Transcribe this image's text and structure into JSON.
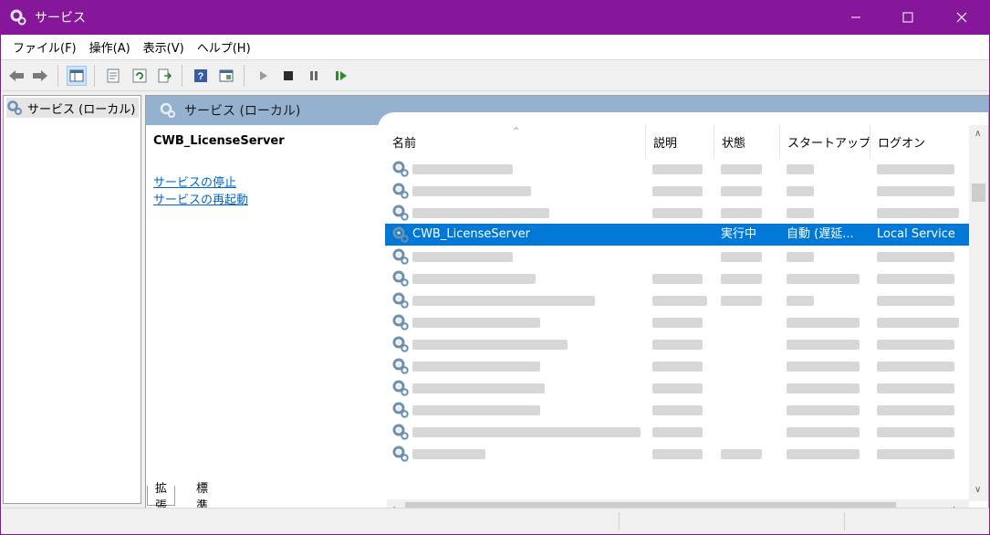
{
  "window": {
    "title": "サービス"
  },
  "menu": [
    "ファイル(F)",
    "操作(A)",
    "表示(V)",
    "ヘルプ(H)"
  ],
  "toolbar": {
    "icons": [
      "back-icon",
      "forward-icon",
      "show-tree-icon",
      "properties-icon",
      "refresh-icon",
      "export-icon",
      "help-icon",
      "console-icon",
      "start-icon",
      "stop-icon",
      "pause-icon",
      "restart-icon"
    ]
  },
  "tree": {
    "root_label": "サービス (ローカル)"
  },
  "pane": {
    "header": "サービス (ローカル)",
    "selected_service": "CWB_LicenseServer",
    "links": [
      "サービスの停止",
      "サービスの再起動"
    ]
  },
  "columns": [
    "名前",
    "説明",
    "状態",
    "スタートアップ...",
    "ログオン"
  ],
  "rows": [
    {
      "name": "",
      "desc": "",
      "status": "",
      "startup": "",
      "logon": "",
      "blurred": true
    },
    {
      "name": "",
      "desc": "",
      "status": "",
      "startup": "",
      "logon": "",
      "blurred": true
    },
    {
      "name": "",
      "desc": "",
      "status": "",
      "startup": "",
      "logon": "",
      "blurred": true
    },
    {
      "name": "CWB_LicenseServer",
      "desc": "",
      "status": "実行中",
      "startup": "自動 (遅延...",
      "logon": "Local Service",
      "selected": true
    },
    {
      "name": "",
      "desc": "",
      "status": "",
      "startup": "",
      "logon": "",
      "blurred": true
    },
    {
      "name": "",
      "desc": "",
      "status": "",
      "startup": "",
      "logon": "",
      "blurred": true
    },
    {
      "name": "",
      "desc": "",
      "status": "",
      "startup": "",
      "logon": "",
      "blurred": true
    },
    {
      "name": "",
      "desc": "",
      "status": "",
      "startup": "",
      "logon": "",
      "blurred": true
    },
    {
      "name": "",
      "desc": "",
      "status": "",
      "startup": "",
      "logon": "",
      "blurred": true
    },
    {
      "name": "",
      "desc": "",
      "status": "",
      "startup": "",
      "logon": "",
      "blurred": true
    },
    {
      "name": "",
      "desc": "",
      "status": "",
      "startup": "",
      "logon": "",
      "blurred": true
    },
    {
      "name": "",
      "desc": "",
      "status": "",
      "startup": "",
      "logon": "",
      "blurred": true
    },
    {
      "name": "",
      "desc": "",
      "status": "",
      "startup": "",
      "logon": "",
      "blurred": true
    },
    {
      "name": "",
      "desc": "",
      "status": "",
      "startup": "",
      "logon": "",
      "blurred": true
    }
  ],
  "tabs": [
    "拡張",
    "標準"
  ],
  "colors": {
    "titlebar": "#87179a",
    "selection": "#0078d7",
    "pane_header": "#94b1cf",
    "link": "#0066cc"
  }
}
